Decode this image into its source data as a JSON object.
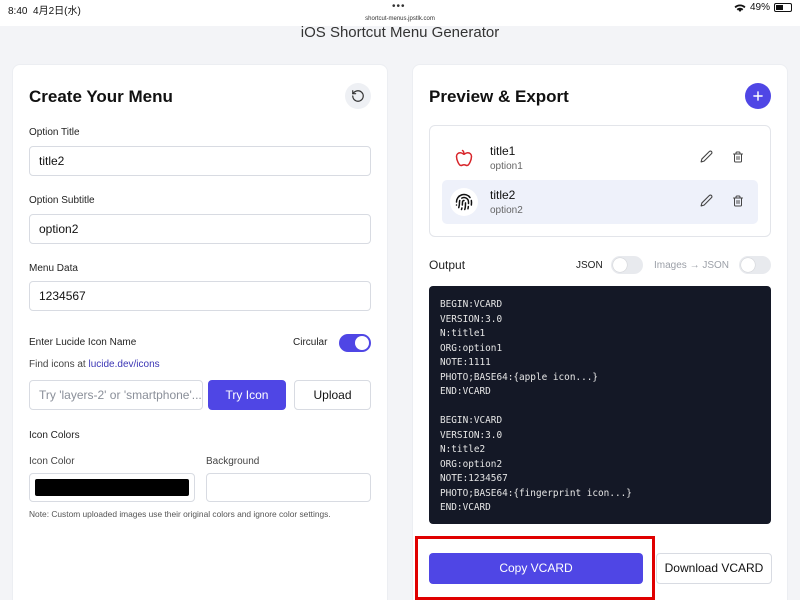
{
  "status_bar": {
    "time": "8:40",
    "date": "4月2日(水)",
    "url": "shortcut-menus.jpstlk.com",
    "battery": "49%",
    "dots": "•••"
  },
  "app_title": "iOS Shortcut Menu Generator",
  "create": {
    "heading": "Create Your Menu",
    "option_title_label": "Option Title",
    "option_title_value": "title2",
    "option_subtitle_label": "Option Subtitle",
    "option_subtitle_value": "option2",
    "menu_data_label": "Menu Data",
    "menu_data_value": "1234567",
    "lucide_label": "Enter Lucide Icon Name",
    "circular_label": "Circular",
    "circular_on": true,
    "find_icons_text": "Find icons at",
    "find_icons_link": "lucide.dev/icons",
    "icon_input_placeholder": "Try 'layers-2' or 'smartphone'...",
    "try_icon_label": "Try Icon",
    "upload_label": "Upload",
    "icon_colors_label": "Icon Colors",
    "icon_color_label": "Icon Color",
    "icon_color_value": "#000000",
    "background_label": "Background",
    "background_value": "#ffffff",
    "note": "Note: Custom uploaded images use their original colors and ignore color settings."
  },
  "preview": {
    "heading": "Preview & Export",
    "items": [
      {
        "title": "title1",
        "subtitle": "option1",
        "icon": "apple-icon",
        "selected": false
      },
      {
        "title": "title2",
        "subtitle": "option2",
        "icon": "fingerprint-icon",
        "selected": true
      }
    ],
    "output_label": "Output",
    "json_label": "JSON",
    "json_on": false,
    "images_json_label": "Images → JSON",
    "images_json_on": false,
    "output_lines": [
      "BEGIN:VCARD",
      "VERSION:3.0",
      "N:title1",
      "ORG:option1",
      "NOTE:1111",
      "PHOTO;BASE64:{apple icon...}",
      "END:VCARD",
      "",
      "BEGIN:VCARD",
      "VERSION:3.0",
      "N:title2",
      "ORG:option2",
      "NOTE:1234567",
      "PHOTO;BASE64:{fingerprint icon...}",
      "END:VCARD"
    ],
    "copy_label": "Copy VCARD",
    "download_label": "Download VCARD"
  },
  "colors": {
    "accent": "#4f46e5",
    "code_bg": "#141826",
    "highlight": "#e00000",
    "apple_red": "#d8262b"
  }
}
